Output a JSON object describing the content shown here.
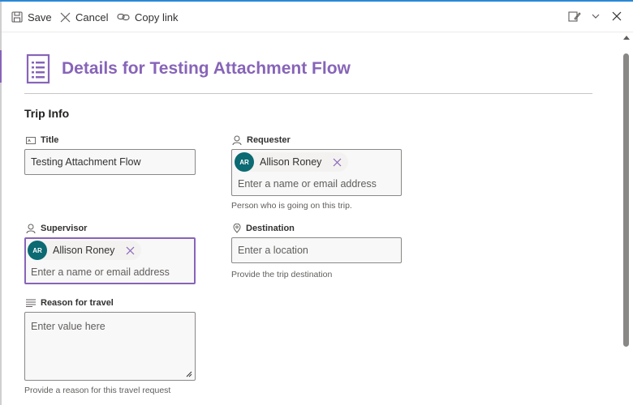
{
  "toolbar": {
    "save_label": "Save",
    "cancel_label": "Cancel",
    "copy_link_label": "Copy link",
    "icons": {
      "save": "save-icon",
      "cancel": "close-icon",
      "copy_link": "link-icon",
      "edit_form": "edit-form-icon",
      "chevron": "chevron-down-icon",
      "close": "close-icon"
    }
  },
  "header": {
    "title": "Details for Testing Attachment Flow",
    "icon": "form-document-icon",
    "accent_color": "#8764b8"
  },
  "section": {
    "title": "Trip Info"
  },
  "fields": {
    "title": {
      "label": "Title",
      "value": "Testing Attachment Flow",
      "icon": "text-field-icon"
    },
    "requester": {
      "label": "Requester",
      "icon": "person-icon",
      "persona": {
        "initials": "AR",
        "name": "Allison Roney"
      },
      "placeholder": "Enter a name or email address",
      "help": "Person who is going on this trip."
    },
    "supervisor": {
      "label": "Supervisor",
      "icon": "person-icon",
      "persona": {
        "initials": "AR",
        "name": "Allison Roney"
      },
      "placeholder": "Enter a name or email address"
    },
    "destination": {
      "label": "Destination",
      "icon": "location-pin-icon",
      "placeholder": "Enter a location",
      "help": "Provide the trip destination"
    },
    "reason": {
      "label": "Reason for travel",
      "icon": "multiline-text-icon",
      "placeholder": "Enter value here",
      "help": "Provide a reason for this travel request"
    }
  },
  "colors": {
    "avatar_bg": "#0b6a72",
    "focus_border": "#8764b8"
  }
}
